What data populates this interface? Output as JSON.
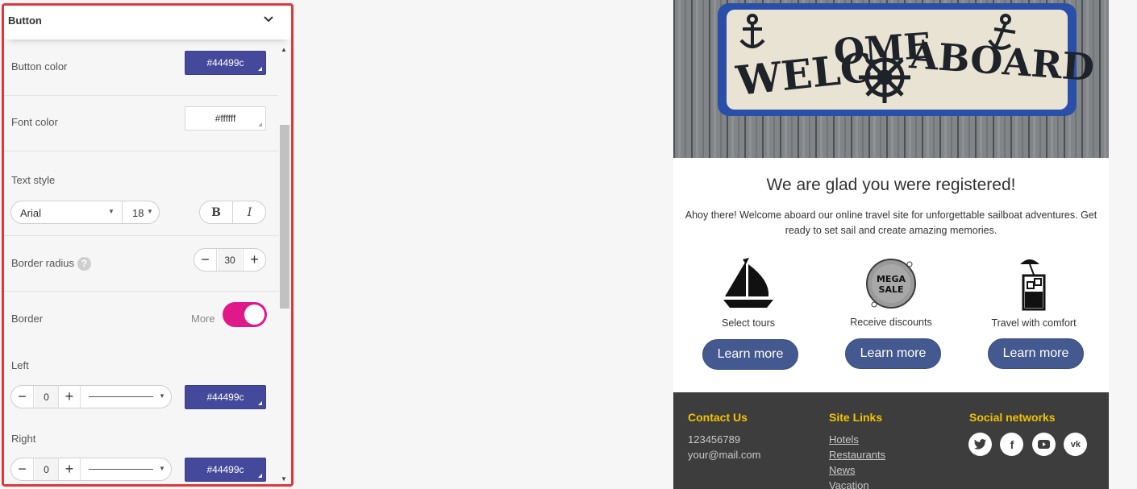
{
  "panel": {
    "title": "Button",
    "button_color": {
      "label": "Button color",
      "value": "#44499c"
    },
    "font_color": {
      "label": "Font color",
      "value": "#ffffff"
    },
    "text_style": {
      "label": "Text style",
      "font": "Arial",
      "size": "18",
      "bold": "B",
      "italic": "I"
    },
    "border_radius": {
      "label": "Border radius",
      "help": "?",
      "value": "30"
    },
    "border": {
      "label": "Border",
      "more": "More",
      "enabled": true
    },
    "left": {
      "label": "Left",
      "width": "0",
      "color": "#44499c"
    },
    "right": {
      "label": "Right",
      "width": "0",
      "color": "#44499c"
    }
  },
  "email": {
    "hero_alt": "WELCOME ABOARD",
    "headline": "We are glad you were registered!",
    "intro": "Ahoy there! Welcome aboard our online travel site for unforgettable sailboat adventures. Get ready to set sail and create amazing memories.",
    "features": [
      {
        "icon": "sailboat-icon",
        "caption": "Select tours",
        "button": "Learn more"
      },
      {
        "icon": "mega-sale-icon",
        "caption": "Receive discounts",
        "button": "Learn more"
      },
      {
        "icon": "cocktail-icon",
        "caption": "Travel with comfort",
        "button": "Learn more"
      }
    ],
    "mega_sale_text": [
      "MEGA",
      "SALE"
    ],
    "footer": {
      "contact": {
        "title": "Contact Us",
        "phone": "123456789",
        "email": "your@mail.com"
      },
      "links": {
        "title": "Site Links",
        "items": [
          "Hotels",
          "Restaurants",
          "News",
          "Vacation"
        ]
      },
      "social": {
        "title": "Social networks",
        "items": [
          "twitter-icon",
          "facebook-icon",
          "youtube-icon",
          "vk-icon"
        ]
      }
    }
  },
  "colors": {
    "accent": "#44499c",
    "toggle": "#e0198b",
    "button": "#44598f",
    "footer_bg": "#3d3d3d",
    "footer_heading": "#f2c200",
    "frame": "#e0373b"
  }
}
